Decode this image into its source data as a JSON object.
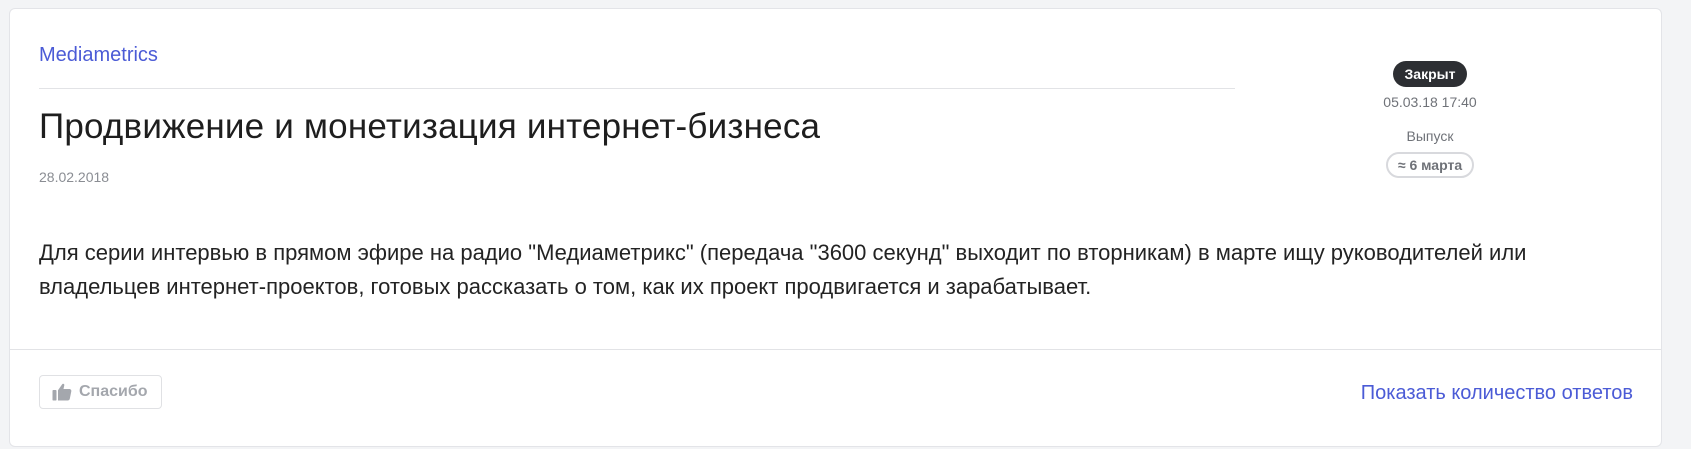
{
  "card": {
    "source": "Mediametrics",
    "title": "Продвижение и монетизация интернет-бизнеса",
    "date": "28.02.2018",
    "description": "Для серии интервью в прямом эфире на радио \"Медиаметрикс\" (передача \"3600 секунд\" выходит по вторникам) в марте ищу руководителей или владельцев интернет-проектов, готовых рассказать о том, как их проект продвигается и зарабатывает."
  },
  "status": {
    "badge": "Закрыт",
    "closed_at": "05.03.18 17:40",
    "release_label": "Выпуск",
    "release_value": "≈ 6 марта"
  },
  "footer": {
    "thanks_label": "Спасибо",
    "thanks_icon": "thumbs-up-icon",
    "answers_link": "Показать количество ответов"
  },
  "colors": {
    "accent": "#4b5bd6",
    "badge_bg": "#2d2f33",
    "muted": "#6f7278"
  }
}
